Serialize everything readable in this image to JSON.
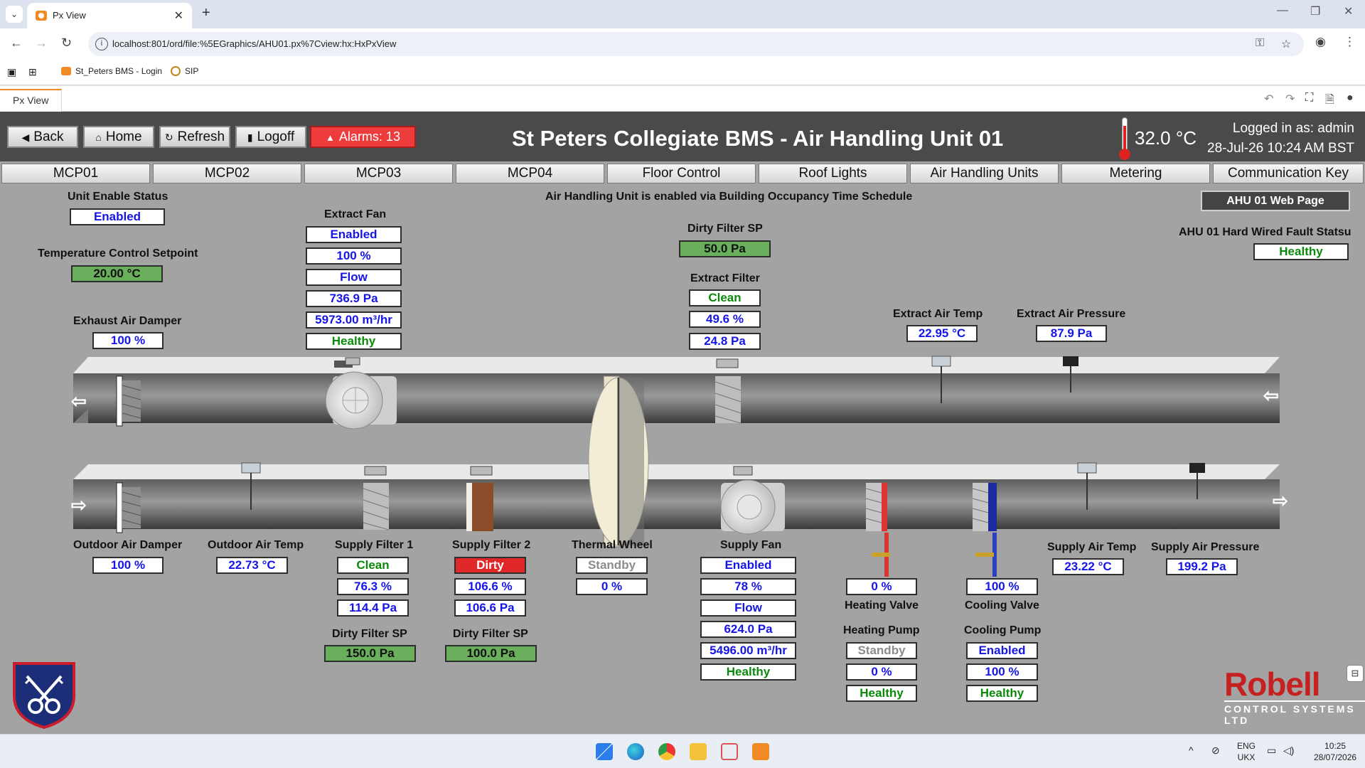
{
  "browser": {
    "tab_title": "Px View",
    "url": "localhost:801/ord/file:%5EGraphics/AHU01.px%7Cview:hx:HxPxView",
    "bookmarks": [
      "St_Peters BMS - Login",
      "SIP"
    ],
    "px_tab": "Px View"
  },
  "header": {
    "buttons": {
      "back": "Back",
      "home": "Home",
      "refresh": "Refresh",
      "logoff": "Logoff"
    },
    "alarms": "Alarms: 13",
    "title": "St Peters Collegiate BMS - Air Handling Unit 01",
    "outside_temp": "32.0 °C",
    "logged_in": "Logged in as: admin",
    "datetime": "28-Jul-26 10:24 AM BST"
  },
  "menu": [
    "MCP01",
    "MCP02",
    "MCP03",
    "MCP04",
    "Floor Control",
    "Roof Lights",
    "Air Handling Units",
    "Metering",
    "Communication Key"
  ],
  "status": {
    "unit_enable_label": "Unit Enable Status",
    "unit_enable_value": "Enabled",
    "schedule_msg": "Air Handling Unit is enabled via Building Occupancy Time Schedule",
    "setpoint_label": "Temperature Control Setpoint",
    "setpoint_value": "20.00 °C",
    "web_page": "AHU 01 Web Page",
    "fault_label": "AHU 01 Hard Wired Fault Statsu",
    "fault_value": "Healthy"
  },
  "extract_fan": {
    "label": "Extract Fan",
    "values": [
      "Enabled",
      "100 %",
      "Flow",
      "736.9 Pa",
      "5973.00 m³/hr",
      "Healthy"
    ]
  },
  "exhaust_damper": {
    "label": "Exhaust Air Damper",
    "value": "100 %"
  },
  "dirty_filter_sp_top": {
    "label": "Dirty Filter SP",
    "value": "50.0 Pa"
  },
  "extract_filter": {
    "label": "Extract Filter",
    "values": [
      "Clean",
      "49.6 %",
      "24.8 Pa"
    ]
  },
  "extract_air_temp": {
    "label": "Extract Air Temp",
    "value": "22.95 °C"
  },
  "extract_air_pressure": {
    "label": "Extract Air Pressure",
    "value": "87.9 Pa"
  },
  "outdoor_damper": {
    "label": "Outdoor Air Damper",
    "value": "100 %"
  },
  "outdoor_air_temp": {
    "label": "Outdoor Air Temp",
    "value": "22.73 °C"
  },
  "supply_filter_1": {
    "label": "Supply Filter 1",
    "values": [
      "Clean",
      "76.3 %",
      "114.4 Pa"
    ],
    "sp_label": "Dirty Filter SP",
    "sp_value": "150.0 Pa"
  },
  "supply_filter_2": {
    "label": "Supply Filter 2",
    "values": [
      "Dirty",
      "106.6 %",
      "106.6 Pa"
    ],
    "sp_label": "Dirty Filter SP",
    "sp_value": "100.0 Pa"
  },
  "thermal_wheel": {
    "label": "Thermal Wheel",
    "values": [
      "Standby",
      "0 %"
    ]
  },
  "supply_fan": {
    "label": "Supply Fan",
    "values": [
      "Enabled",
      "78 %",
      "Flow",
      "624.0 Pa",
      "5496.00 m³/hr",
      "Healthy"
    ]
  },
  "heating": {
    "valve_value": "0 %",
    "valve_label": "Heating Valve",
    "pump_label": "Heating Pump",
    "pump_values": [
      "Standby",
      "0 %",
      "Healthy"
    ]
  },
  "cooling": {
    "valve_value": "100 %",
    "valve_label": "Cooling Valve",
    "pump_label": "Cooling Pump",
    "pump_values": [
      "Enabled",
      "100 %",
      "Healthy"
    ]
  },
  "supply_air_temp": {
    "label": "Supply Air Temp",
    "value": "23.22 °C"
  },
  "supply_air_pressure": {
    "label": "Supply Air Pressure",
    "value": "199.2 Pa"
  },
  "logo": {
    "name": "Robell",
    "tagline": "CONTROL SYSTEMS LTD"
  },
  "taskbar": {
    "lang1": "ENG",
    "lang2": "UKX",
    "time": "10:25",
    "date": "28/07/2026"
  },
  "colors": {
    "value_blue": "#1515e6",
    "healthy_green": "#0a8a0a",
    "sp_green": "#6aaf5c",
    "alarm_red": "#ee3b3b",
    "panel_grey": "#a3a3a3"
  }
}
